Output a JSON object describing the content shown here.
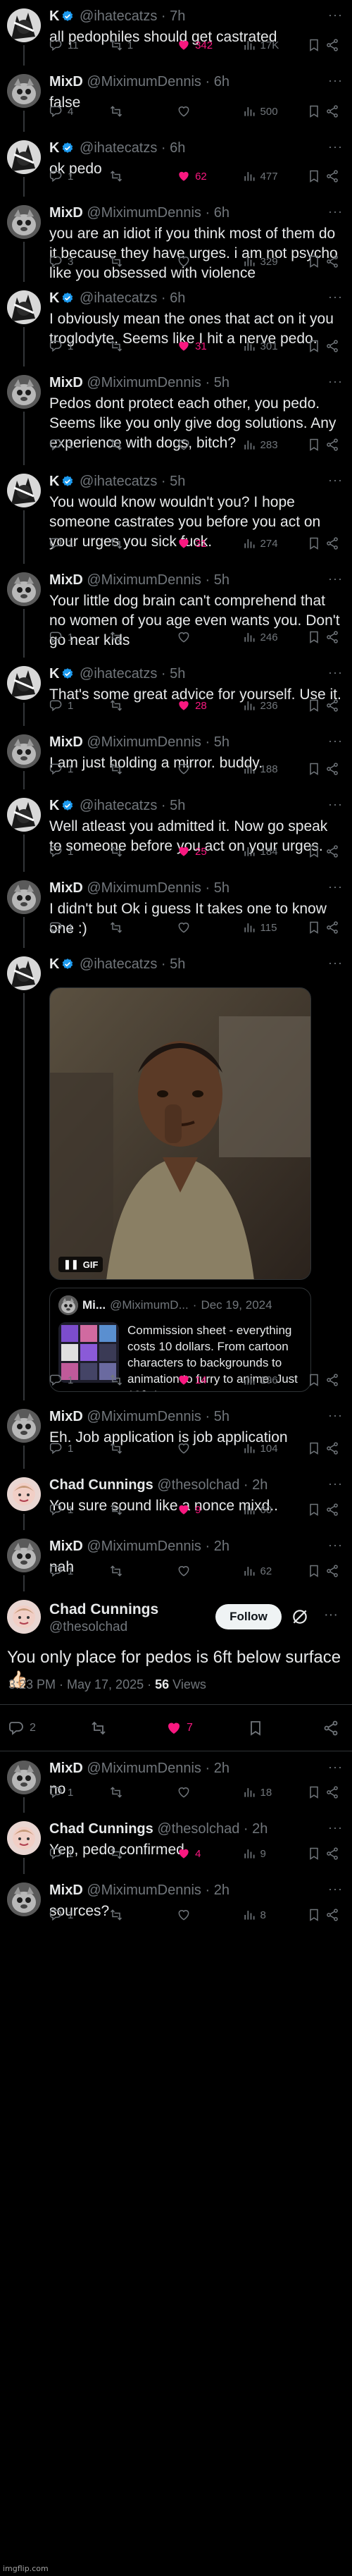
{
  "colors": {
    "background": "#000000",
    "text": "#e7e9ea",
    "muted": "#71767b",
    "like": "#f91880",
    "verified": "#1d9bf0"
  },
  "icons": [
    "reply-icon",
    "retweet-icon",
    "like-icon",
    "views-icon",
    "bookmark-icon",
    "share-icon",
    "verified-badge-icon",
    "more-icon",
    "grok-icon",
    "gif-pause-icon"
  ],
  "replies": [
    {
      "name": "K",
      "verified": true,
      "handle": "@ihatecatzs",
      "time": "7h",
      "text": "all pedophiles should get castrated",
      "stats": {
        "replies": "11",
        "retweets": "1",
        "likes": "342",
        "liked": true,
        "views": "17K"
      }
    },
    {
      "name": "MixD",
      "verified": false,
      "handle": "@MiximumDennis",
      "time": "6h",
      "text": "false",
      "stats": {
        "replies": "4",
        "retweets": "",
        "likes": "",
        "liked": false,
        "views": "500"
      }
    },
    {
      "name": "K",
      "verified": true,
      "handle": "@ihatecatzs",
      "time": "6h",
      "text": "ok pedo",
      "stats": {
        "replies": "1",
        "retweets": "",
        "likes": "62",
        "liked": true,
        "views": "477"
      }
    },
    {
      "name": "MixD",
      "verified": false,
      "handle": "@MiximumDennis",
      "time": "6h",
      "text": "you are an idiot if you think most of them do it because they have urges. i am not psycho like you obsessed with violence",
      "stats": {
        "replies": "3",
        "retweets": "",
        "likes": "",
        "liked": false,
        "views": "329"
      }
    },
    {
      "name": "K",
      "verified": true,
      "handle": "@ihatecatzs",
      "time": "6h",
      "text": "I obviously mean the ones that act on it you troglodyte. Seems like I hit a nerve pedo.",
      "stats": {
        "replies": "1",
        "retweets": "",
        "likes": "31",
        "liked": true,
        "views": "301"
      }
    },
    {
      "name": "MixD",
      "verified": false,
      "handle": "@MiximumDennis",
      "time": "5h",
      "text": "Pedos dont protect each other, you pedo. Seems like you only give dog solutions. Any experience with dogs, bitch?",
      "stats": {
        "replies": "1",
        "retweets": "",
        "likes": "",
        "liked": false,
        "views": "283"
      }
    },
    {
      "name": "K",
      "verified": true,
      "handle": "@ihatecatzs",
      "time": "5h",
      "text": "You would know wouldn't you? I hope someone castrates you before you act on your urges you sick fuck.",
      "stats": {
        "replies": "1",
        "retweets": "",
        "likes": "31",
        "liked": true,
        "views": "274"
      }
    },
    {
      "name": "MixD",
      "verified": false,
      "handle": "@MiximumDennis",
      "time": "5h",
      "text": "Your little dog brain can't comprehend that no women of you age even wants you. Don't go near kids",
      "stats": {
        "replies": "1",
        "retweets": "",
        "likes": "",
        "liked": false,
        "views": "246"
      }
    },
    {
      "name": "K",
      "verified": true,
      "handle": "@ihatecatzs",
      "time": "5h",
      "text": "That's some great advice for yourself. Use it.",
      "stats": {
        "replies": "1",
        "retweets": "",
        "likes": "28",
        "liked": true,
        "views": "236"
      }
    },
    {
      "name": "MixD",
      "verified": false,
      "handle": "@MiximumDennis",
      "time": "5h",
      "text": "I am just holding a mirror. buddy.",
      "stats": {
        "replies": "1",
        "retweets": "",
        "likes": "",
        "liked": false,
        "views": "188"
      }
    },
    {
      "name": "K",
      "verified": true,
      "handle": "@ihatecatzs",
      "time": "5h",
      "text": "Well atleast you admitted it. Now go speak to someone before you act on your urges.",
      "stats": {
        "replies": "1",
        "retweets": "",
        "likes": "25",
        "liked": true,
        "views": "184"
      }
    },
    {
      "name": "MixD",
      "verified": false,
      "handle": "@MiximumDennis",
      "time": "5h",
      "text": "I didn't but Ok i guess It takes one to know one :)",
      "stats": {
        "replies": "1",
        "retweets": "",
        "likes": "",
        "liked": false,
        "views": "115"
      }
    },
    {
      "name": "K",
      "verified": true,
      "handle": "@ihatecatzs",
      "time": "5h",
      "text": "",
      "media": {
        "badge": "GIF"
      },
      "quote": {
        "name": "Mi...",
        "handle": "@MiximumD...",
        "date": "Dec 19, 2024",
        "text": "Commission sheet - everything costs 10 dollars. From cartoon characters to backgrounds to animation to furry to anime. Just 10$. I ..."
      },
      "stats": {
        "replies": "1",
        "retweets": "",
        "likes": "14",
        "liked": true,
        "views": "196"
      }
    },
    {
      "name": "MixD",
      "verified": false,
      "handle": "@MiximumDennis",
      "time": "5h",
      "text": "Eh. Job application is job application",
      "stats": {
        "replies": "1",
        "retweets": "",
        "likes": "",
        "liked": false,
        "views": "104"
      }
    },
    {
      "name": "Chad Cunnings",
      "verified": false,
      "handle": "@thesolchad",
      "time": "2h",
      "text": "You sure sound like a nonce mixd..",
      "stats": {
        "replies": "1",
        "retweets": "",
        "likes": "9",
        "liked": true,
        "views": "60"
      }
    },
    {
      "name": "MixD",
      "verified": false,
      "handle": "@MiximumDennis",
      "time": "2h",
      "text": "nah",
      "stats": {
        "replies": "1",
        "retweets": "",
        "likes": "",
        "liked": false,
        "views": "62"
      }
    }
  ],
  "main_tweet": {
    "name": "Chad Cunnings",
    "handle": "@thesolchad",
    "follow_label": "Follow",
    "text": "You only place for pedos is 6ft below surface 👍🏻",
    "timestamp": "3:23 PM · May 17, 2025 · ",
    "views_count": "56",
    "views_label": " Views",
    "stats": {
      "replies": "2",
      "retweets": "",
      "likes": "7",
      "liked": true
    }
  },
  "after_replies": [
    {
      "name": "MixD",
      "verified": false,
      "handle": "@MiximumDennis",
      "time": "2h",
      "text": "no",
      "stats": {
        "replies": "1",
        "retweets": "",
        "likes": "",
        "liked": false,
        "views": "18"
      }
    },
    {
      "name": "Chad Cunnings",
      "verified": false,
      "handle": "@thesolchad",
      "time": "2h",
      "text": "Yep, pedo confirmed",
      "stats": {
        "replies": "1",
        "retweets": "",
        "likes": "4",
        "liked": true,
        "views": "9"
      }
    },
    {
      "name": "MixD",
      "verified": false,
      "handle": "@MiximumDennis",
      "time": "2h",
      "text": "sources?",
      "stats": {
        "replies": "1",
        "retweets": "",
        "likes": "",
        "liked": false,
        "views": "8"
      }
    }
  ],
  "watermark": "imgflip.com"
}
